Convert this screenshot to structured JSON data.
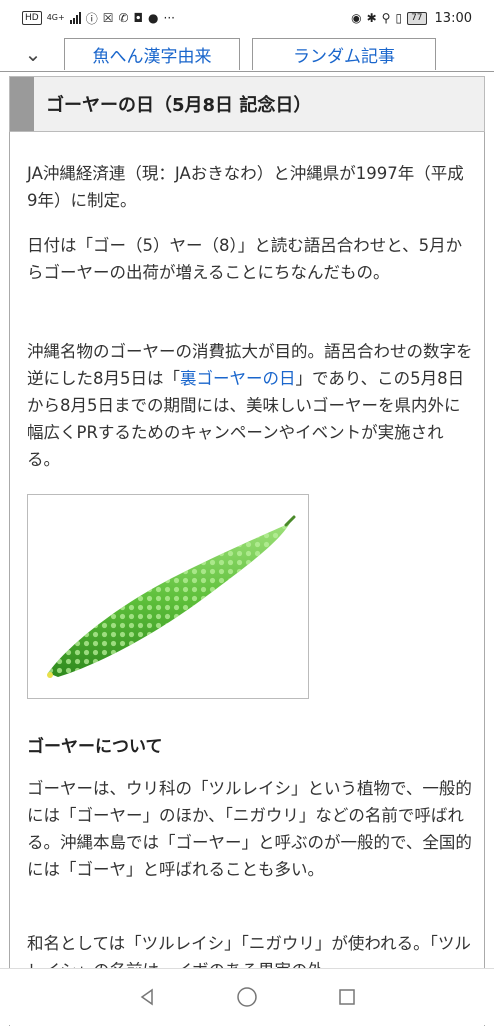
{
  "status_bar": {
    "hd": "HD",
    "network": "4G+",
    "battery": "77",
    "time": "13:00"
  },
  "nav": {
    "tabs": [
      {
        "label": "魚へん漢字由来"
      },
      {
        "label": "ランダム記事"
      }
    ]
  },
  "article": {
    "title": "ゴーヤーの日（5月8日 記念日）",
    "p1": "JA沖縄経済連（現：JAおきなわ）と沖縄県が1997年（平成9年）に制定。",
    "p2": "日付は「ゴー（5）ヤー（8）」と読む語呂合わせと、5月からゴーヤーの出荷が増えることにちなんだもの。",
    "p3_before": "沖縄名物のゴーヤーの消費拡大が目的。語呂合わせの数字を逆にした8月5日は「",
    "p3_link": "裏ゴーヤーの日",
    "p3_after": "」であり、この5月8日から8月5日までの期間には、美味しいゴーヤーを県内外に幅広くPRするためのキャンペーンやイベントが実施される。",
    "subheading": "ゴーヤーについて",
    "p4": "ゴーヤーは、ウリ科の「ツルレイシ」という植物で、一般的には「ゴーヤー」のほか、「ニガウリ」などの名前で呼ばれる。沖縄本島では「ゴーヤー」と呼ぶのが一般的で、全国的には「ゴーヤ」と呼ばれることも多い。",
    "p5": "和名としては「ツルレイシ」「ニガウリ」が使われる。「ツルレイシ」の名前は、イボのある果実の外"
  },
  "colors": {
    "link": "#1a66cc",
    "heading_bar": "#9a9a9a",
    "heading_bg": "#f0f0f0"
  }
}
